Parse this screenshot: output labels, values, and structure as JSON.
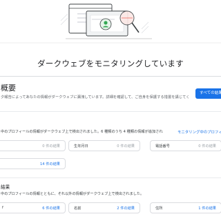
{
  "header": {
    "title": "ダークウェブをモニタリングしています"
  },
  "overview": {
    "title": "概要",
    "description": "夕報告によってあなたの情報がダークウェブに漏洩しています。詳細を確認して、ご自身を保護する措置を講じてく",
    "button_label": "すべての結果"
  },
  "monitored_profile": {
    "summary": "中のプロフィールの情報がダークウェブ上で検出されました。6 種類のうち 4 種類の情報が追加され",
    "link_label": "モニタリング中のプロフィ",
    "items": [
      {
        "label": "",
        "value": "0 件の結果"
      },
      {
        "label": "生年月日",
        "value": "0 件の結果"
      },
      {
        "label": "電話番号",
        "value": "0 件の結果"
      },
      {
        "label": "",
        "value": "14 件の結果"
      }
    ]
  },
  "other_results": {
    "title": "結果",
    "summary": "中のプロフィールの情報とともに、それ以外の情報がダークウェブ上で検出されました。",
    "items": [
      {
        "label": "f",
        "value": "6 件の結果"
      },
      {
        "label": "名前",
        "value": "2 件の結果"
      },
      {
        "label": "住所",
        "value": "1 件の結果"
      }
    ]
  },
  "colors": {
    "accent": "#1a73e8",
    "border": "#dadce0",
    "muted_text": "#9aa0a6"
  },
  "icons": [
    "browser-window-illustration",
    "magnifier-icon",
    "shield-icon"
  ]
}
